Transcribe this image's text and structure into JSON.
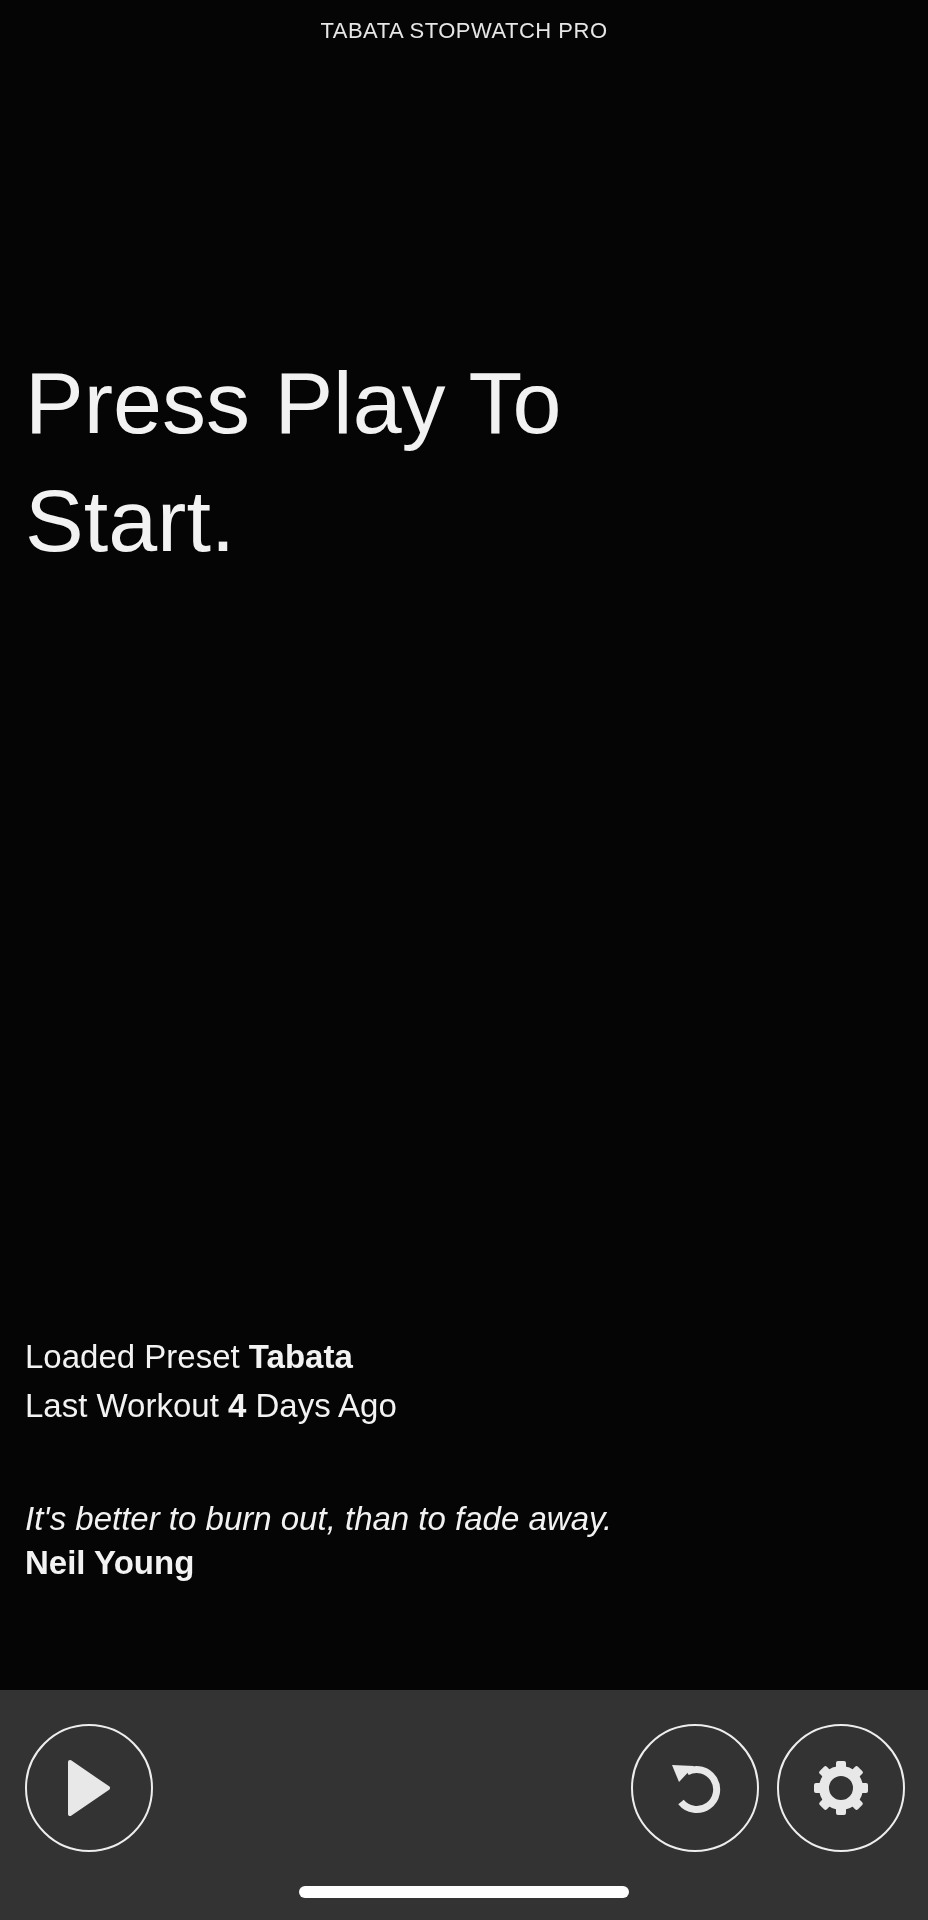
{
  "app_title": "TABATA STOPWATCH PRO",
  "prompt": "Press Play To Start.",
  "info_lines": [
    "Loaded Preset **Tabata**",
    "Last Workout **4** Days Ago"
  ],
  "quote": {
    "text": "It's better to burn out, than to fade away.",
    "author": "Neil Young"
  },
  "toolbar": {
    "buttons": [
      {
        "kind": "play"
      },
      {
        "kind": "reset"
      },
      {
        "kind": "settings"
      }
    ]
  }
}
